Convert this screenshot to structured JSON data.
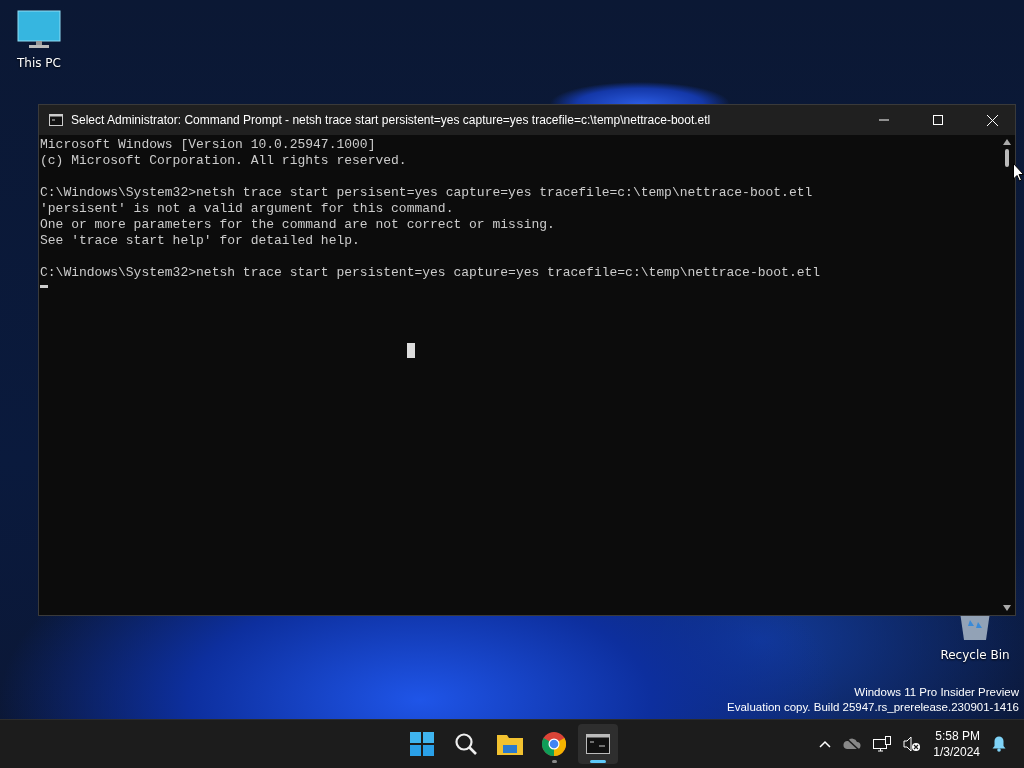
{
  "desktop_icons": [
    {
      "kind": "pc",
      "label": "This PC"
    },
    {
      "kind": "bin",
      "label": "Recycle Bin"
    }
  ],
  "window": {
    "title": "Select Administrator: Command Prompt - netsh  trace start persistent=yes capture=yes tracefile=c:\\temp\\nettrace-boot.etl"
  },
  "console": {
    "blocks": [
      [
        "Microsoft Windows [Version 10.0.25947.1000]",
        "(c) Microsoft Corporation. All rights reserved."
      ],
      [
        "C:\\Windows\\System32>netsh trace start persisent=yes capture=yes tracefile=c:\\temp\\nettrace-boot.etl",
        "'persisent' is not a valid argument for this command.",
        "One or more parameters for the command are not correct or missing.",
        "See 'trace start help' for detailed help."
      ],
      [
        "C:\\Windows\\System32>netsh trace start persistent=yes capture=yes tracefile=c:\\temp\\nettrace-boot.etl"
      ]
    ]
  },
  "watermark": [
    "Windows 11 Pro Insider Preview",
    "Evaluation copy. Build 25947.rs_prerelease.230901-1416"
  ],
  "taskbar": {
    "apps": [
      {
        "kind": "start",
        "running": false,
        "active": false
      },
      {
        "kind": "search",
        "running": false,
        "active": false
      },
      {
        "kind": "explorer",
        "running": false,
        "active": false
      },
      {
        "kind": "chrome",
        "running": true,
        "active": false
      },
      {
        "kind": "cmd",
        "running": true,
        "active": true
      }
    ],
    "time": "5:58 PM",
    "date": "1/3/2024"
  }
}
